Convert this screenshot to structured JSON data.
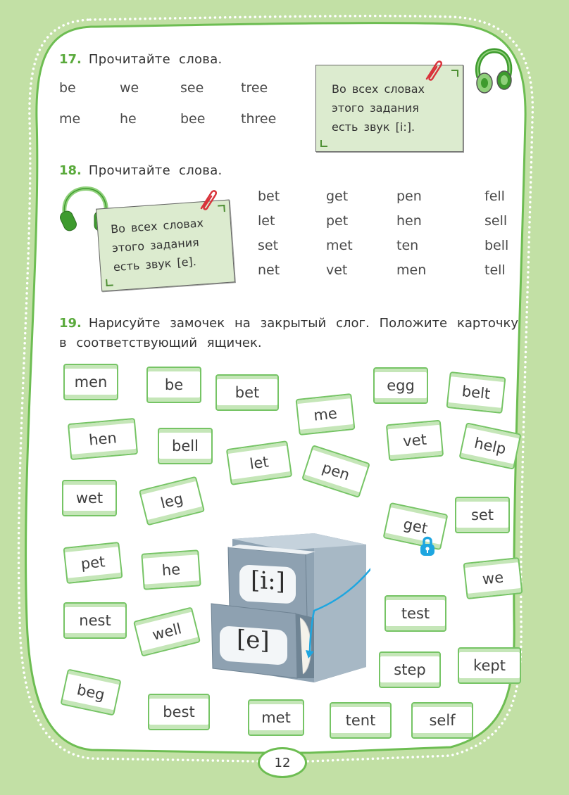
{
  "theme": {
    "accent_green": "#5aaa3c",
    "page_bg": "#c2e0a5",
    "card_border": "#76c465",
    "note_bg": "#dcebcf",
    "arrow_blue": "#1ea6e0"
  },
  "ex17": {
    "number": "17.",
    "title": "Прочитайте слова.",
    "rows": [
      [
        "be",
        "we",
        "see",
        "tree"
      ],
      [
        "me",
        "he",
        "bee",
        "three"
      ]
    ],
    "note": [
      "Во всех словах",
      "этого задания",
      "есть звук [i:]."
    ],
    "icons": {
      "headphones": "headphones-icon",
      "clip": "paperclip-icon"
    }
  },
  "ex18": {
    "number": "18.",
    "title": "Прочитайте слова.",
    "rows": [
      [
        "bet",
        "get",
        "pen",
        "fell"
      ],
      [
        "let",
        "pet",
        "hen",
        "sell"
      ],
      [
        "set",
        "met",
        "ten",
        "bell"
      ],
      [
        "net",
        "vet",
        "men",
        "tell"
      ]
    ],
    "note": [
      "Во всех словах",
      "этого задания",
      "есть звук [e]."
    ],
    "icons": {
      "headphones": "headphones-icon",
      "clip": "paperclip-icon"
    }
  },
  "ex19": {
    "number": "19.",
    "instruction": "Нарисуйте замочек на закрытый слог. Положите карточку в соответствующий ящичек.",
    "cabinet": {
      "top_drawer_label": "[i:]",
      "bottom_drawer_label": "[e]"
    },
    "cards": [
      {
        "word": "men"
      },
      {
        "word": "be"
      },
      {
        "word": "bet"
      },
      {
        "word": "me"
      },
      {
        "word": "egg"
      },
      {
        "word": "belt"
      },
      {
        "word": "hen"
      },
      {
        "word": "bell"
      },
      {
        "word": "let"
      },
      {
        "word": "pen"
      },
      {
        "word": "vet"
      },
      {
        "word": "help"
      },
      {
        "word": "wet"
      },
      {
        "word": "leg"
      },
      {
        "word": "get",
        "locked": true
      },
      {
        "word": "set"
      },
      {
        "word": "pet"
      },
      {
        "word": "he"
      },
      {
        "word": "we"
      },
      {
        "word": "test"
      },
      {
        "word": "nest"
      },
      {
        "word": "well"
      },
      {
        "word": "step"
      },
      {
        "word": "kept"
      },
      {
        "word": "beg"
      },
      {
        "word": "best"
      },
      {
        "word": "met"
      },
      {
        "word": "tent"
      },
      {
        "word": "self"
      }
    ]
  },
  "page_number": "12"
}
